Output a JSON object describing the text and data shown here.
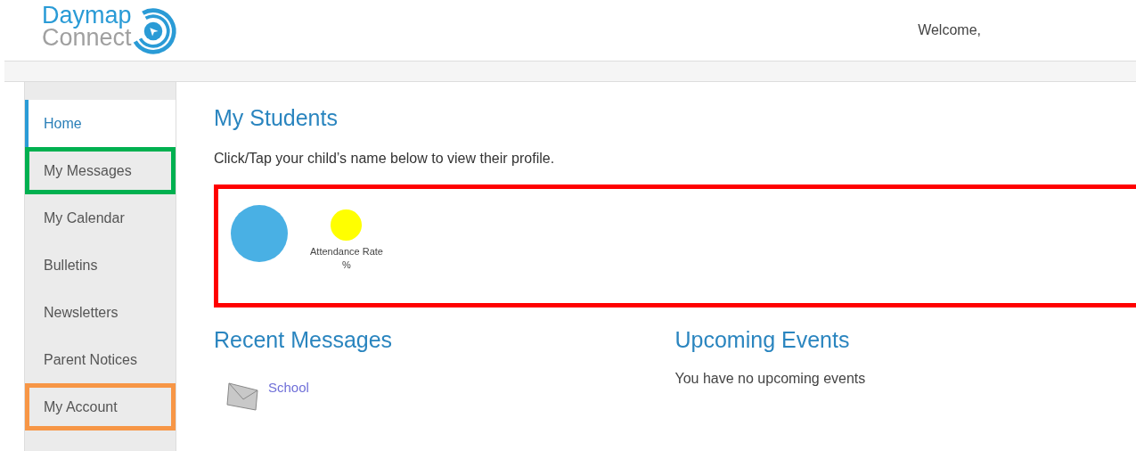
{
  "header": {
    "logo": {
      "line_1": "Daymap",
      "line_2": "Connect"
    },
    "welcome": "Welcome,"
  },
  "sidebar": {
    "items": [
      {
        "label": "Home",
        "selected": true
      },
      {
        "label": "My Messages",
        "selected": false,
        "color": "#00b050"
      },
      {
        "label": "My Calendar",
        "selected": false
      },
      {
        "label": "Bulletins",
        "selected": false
      },
      {
        "label": "Newsletters",
        "selected": false
      },
      {
        "label": "Parent Notices",
        "selected": false
      },
      {
        "label": "My Account",
        "selected": false,
        "color": "#f79646"
      }
    ]
  },
  "students": {
    "title": "My Students",
    "instruction": "Click/Tap your child’s name below to view their profile.",
    "color": "#ff0000",
    "attendance": {
      "label": "Attendance Rate",
      "value": "%"
    }
  },
  "recent_messages": {
    "title": "Recent Messages",
    "items": [
      {
        "sender": "School"
      }
    ]
  },
  "upcoming_events": {
    "title": "Upcoming Events",
    "empty_text": "You have no upcoming events"
  }
}
